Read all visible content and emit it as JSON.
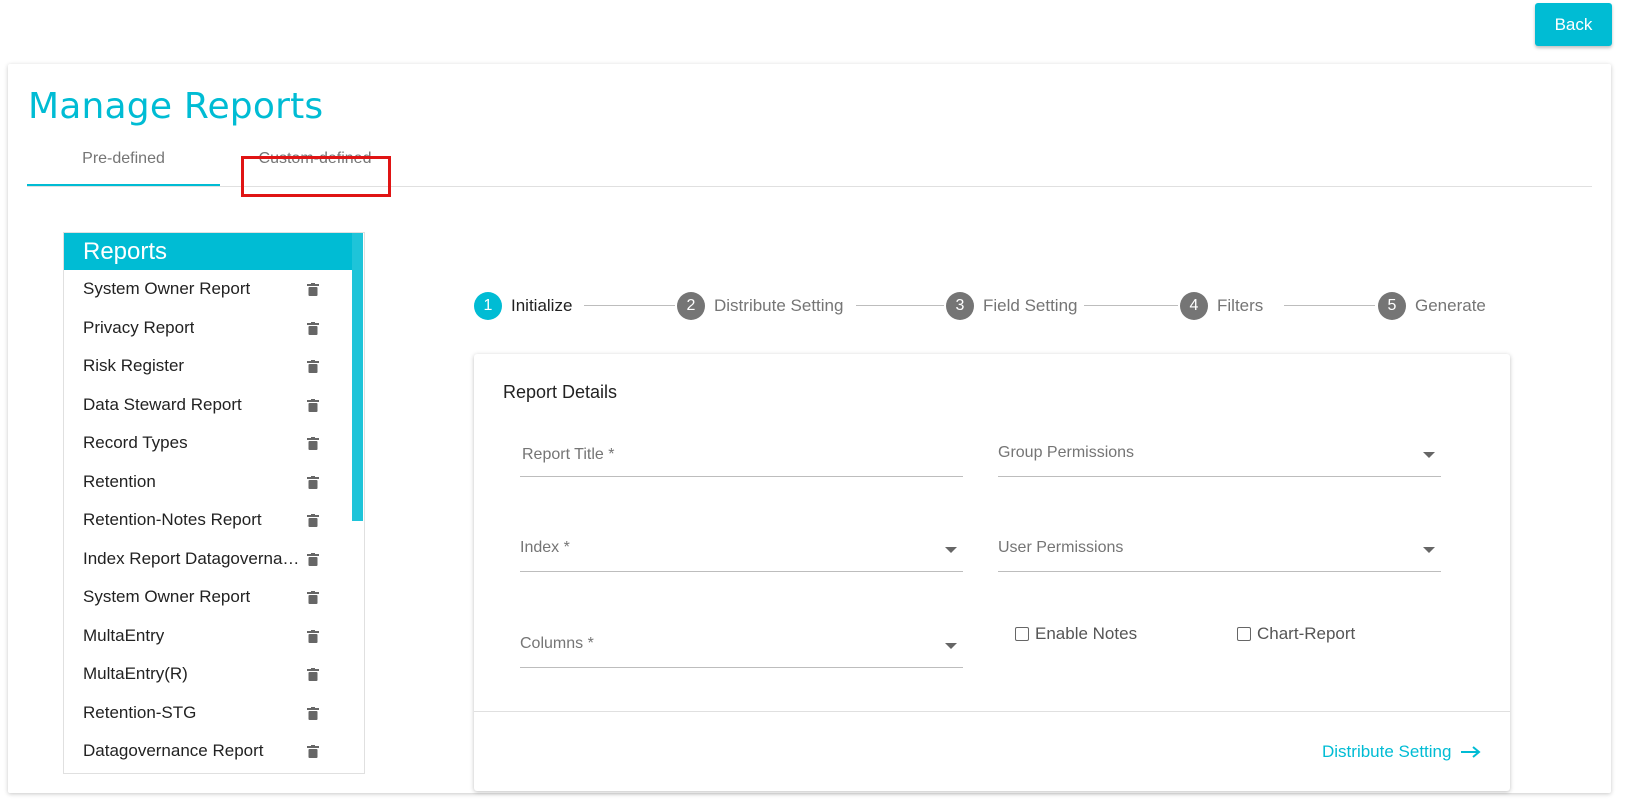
{
  "header": {
    "back_label": "Back"
  },
  "page": {
    "title": "Manage Reports"
  },
  "tabs": [
    {
      "label": "Pre-defined",
      "active": true
    },
    {
      "label": "Custom-defined",
      "active": false,
      "highlighted": true
    }
  ],
  "sidebar": {
    "title": "Reports",
    "item_icon": "trash-icon",
    "items": [
      "System Owner Report",
      "Privacy Report",
      "Risk Register",
      "Data Steward Report",
      "Record Types",
      "Retention",
      "Retention-Notes Report",
      "Index Report Datagovernance",
      "System Owner Report",
      "MultaEntry",
      "MultaEntry(R)",
      "Retention-STG",
      "Datagovernance Report"
    ]
  },
  "stepper": {
    "steps": [
      {
        "number": "1",
        "label": "Initialize",
        "active": true
      },
      {
        "number": "2",
        "label": "Distribute Setting",
        "active": false
      },
      {
        "number": "3",
        "label": "Field Setting",
        "active": false
      },
      {
        "number": "4",
        "label": "Filters",
        "active": false
      },
      {
        "number": "5",
        "label": "Generate",
        "active": false
      }
    ]
  },
  "form": {
    "heading": "Report Details",
    "report_title_placeholder": "Report Title *",
    "group_permissions_placeholder": "Group Permissions",
    "index_placeholder": "Index *",
    "user_permissions_placeholder": "User Permissions",
    "columns_placeholder": "Columns *",
    "enable_notes_label": "Enable Notes",
    "chart_report_label": "Chart-Report",
    "next_label": "Distribute Setting"
  },
  "colors": {
    "accent": "#00bcd4",
    "step_inactive": "#757575",
    "highlight": "#e01414"
  }
}
